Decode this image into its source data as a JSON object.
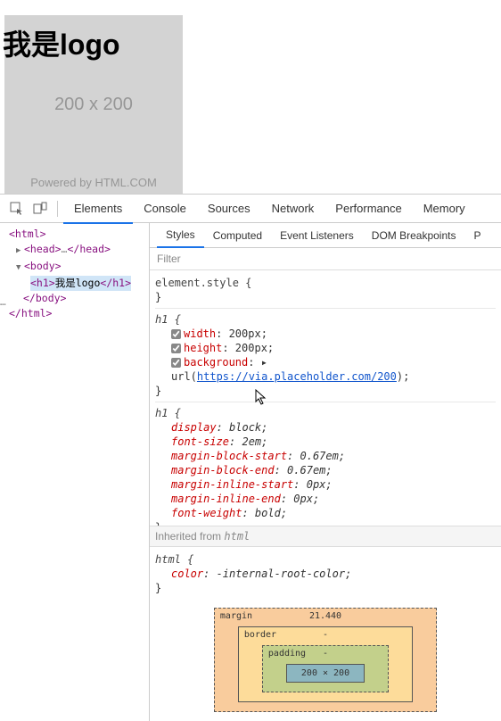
{
  "preview": {
    "h1_text": "我是logo",
    "dim_text": "200 x 200",
    "powered_text": "Powered by HTML.COM"
  },
  "tabs_main": [
    "Elements",
    "Console",
    "Sources",
    "Network",
    "Performance",
    "Memory"
  ],
  "dom": {
    "l0": "<html>",
    "l1_open": "<head>",
    "l1_ell": "…",
    "l1_close": "</head>",
    "l2": "<body>",
    "l3_open": "<h1>",
    "l3_txt": "我是logo",
    "l3_close": "</h1>",
    "l4": "</body>",
    "l5": "</html>"
  },
  "subtabs": [
    "Styles",
    "Computed",
    "Event Listeners",
    "DOM Breakpoints",
    "P"
  ],
  "filter_placeholder": "Filter",
  "rules": {
    "r0": {
      "sel": "element.style {",
      "close": "}"
    },
    "r1": {
      "sel": "h1 {",
      "p1_prop": "width",
      "p1_val": ": 200px;",
      "p2_prop": "height",
      "p2_val": ": 200px;",
      "p3_prop": "background",
      "p3_val_a": ": ▸ url(",
      "p3_url": "https://via.placeholder.com/200",
      "p3_val_b": ");",
      "close": "}"
    },
    "r2": {
      "sel": "h1 {",
      "p1_prop": "display",
      "p1_val": ": block;",
      "p2_prop": "font-size",
      "p2_val": ": 2em;",
      "p3_prop": "margin-block-start",
      "p3_val": ": 0.67em;",
      "p4_prop": "margin-block-end",
      "p4_val": ": 0.67em;",
      "p5_prop": "margin-inline-start",
      "p5_val": ": 0px;",
      "p6_prop": "margin-inline-end",
      "p6_val": ": 0px;",
      "p7_prop": "font-weight",
      "p7_val": ": bold;",
      "close": "}"
    },
    "inherit_label": "Inherited from ",
    "inherit_from": "html",
    "r3": {
      "sel": "html {",
      "p1_prop": "color",
      "p1_val": ": -internal-root-color;",
      "close": "}"
    }
  },
  "box_model": {
    "margin_label": "margin",
    "margin_top": "21.440",
    "border_label": "border",
    "border_top": "-",
    "padding_label": "padding",
    "padding_top": "-",
    "content": "200 × 200"
  }
}
